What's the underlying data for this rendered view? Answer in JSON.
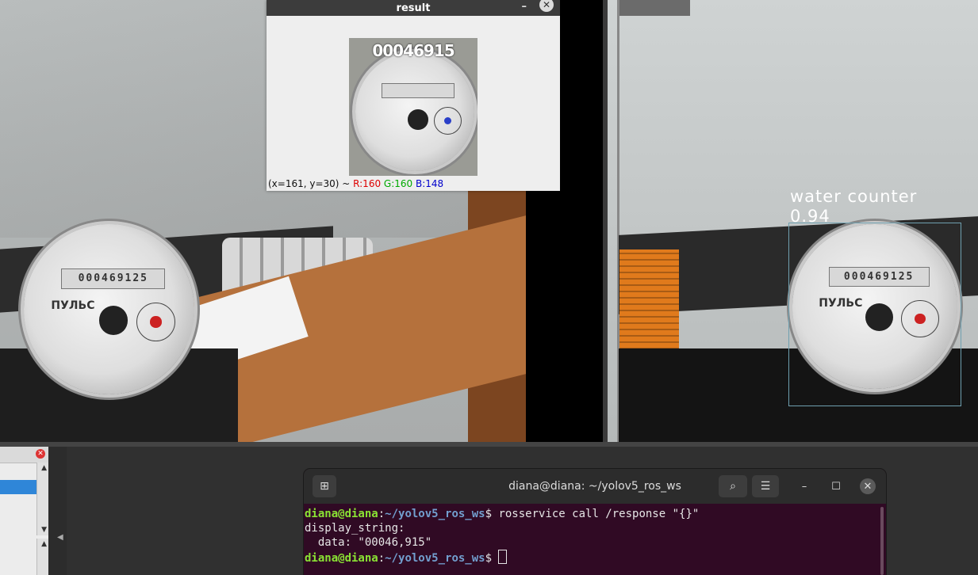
{
  "result_window": {
    "title": "result",
    "ocr_text": "00046915",
    "status": {
      "coords": "(x=161, y=30) ~ ",
      "r": "R:160",
      "g": "G:160",
      "b": "B:148"
    }
  },
  "meter": {
    "digits": "000469125",
    "brand": "ПУЛЬС"
  },
  "detection": {
    "label": "water counter",
    "confidence": "0.94"
  },
  "terminal": {
    "title": "diana@diana: ~/yolov5_ros_ws",
    "lines": [
      {
        "user": "diana@diana",
        "path": "~/yolov5_ros_ws",
        "cmd": "$ rosservice call /response \"{}\""
      },
      {
        "text": "display_string:"
      },
      {
        "text": "  data: \"00046,915\""
      },
      {
        "user": "diana@diana",
        "path": "~/yolov5_ros_ws",
        "cmd": "$ "
      }
    ]
  },
  "colors": {
    "terminal_bg": "#300a24",
    "prompt_user": "#8ae234",
    "prompt_path": "#729fcf",
    "selection": "#2f86d8"
  },
  "icons": [
    "new-tab-icon",
    "search-icon",
    "hamburger-menu-icon",
    "minimize-icon",
    "maximize-icon",
    "close-icon"
  ]
}
